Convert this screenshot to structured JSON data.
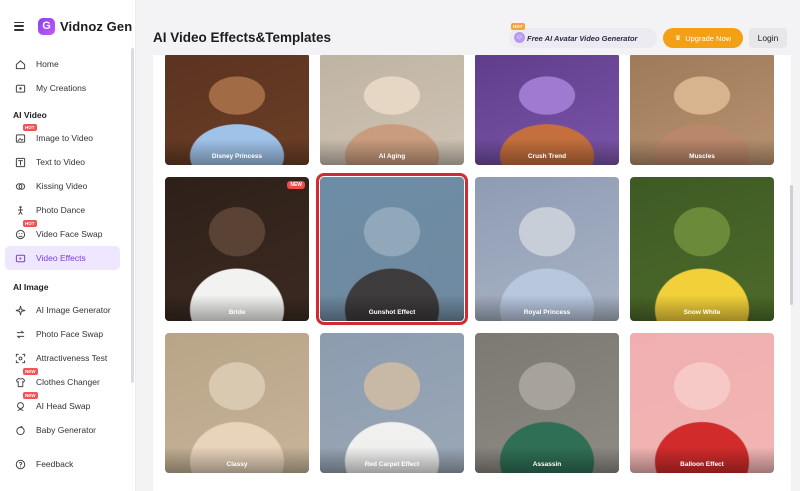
{
  "app": {
    "logo_text": "Vidnoz Gen",
    "logo_mark": "G"
  },
  "sidebar": {
    "nav": [
      {
        "label": "Home",
        "icon": "home-icon"
      },
      {
        "label": "My Creations",
        "icon": "folder-icon"
      }
    ],
    "sections": [
      {
        "title": "AI Video",
        "items": [
          {
            "label": "Image to Video",
            "icon": "image-icon",
            "tag": "HOT"
          },
          {
            "label": "Text to Video",
            "icon": "text-icon"
          },
          {
            "label": "Kissing Video",
            "icon": "kiss-icon"
          },
          {
            "label": "Photo Dance",
            "icon": "dance-icon"
          },
          {
            "label": "Video Face Swap",
            "icon": "face-swap-icon",
            "tag": "HOT"
          },
          {
            "label": "Video Effects",
            "icon": "effects-icon",
            "active": true
          }
        ]
      },
      {
        "title": "AI Image",
        "items": [
          {
            "label": "AI Image Generator",
            "icon": "sparkle-icon"
          },
          {
            "label": "Photo Face Swap",
            "icon": "swap-icon"
          },
          {
            "label": "Attractiveness Test",
            "icon": "test-icon"
          },
          {
            "label": "Clothes Changer",
            "icon": "shirt-icon",
            "tag": "NEW"
          },
          {
            "label": "AI Head Swap",
            "icon": "head-icon",
            "tag": "NEW"
          },
          {
            "label": "Baby Generator",
            "icon": "baby-icon"
          }
        ]
      }
    ],
    "footer": {
      "label": "Feedback",
      "icon": "feedback-icon"
    }
  },
  "header": {
    "title": "AI Video Effects&Templates",
    "promo_label": "Free AI Avatar Video Generator",
    "promo_tag": "HOT",
    "upgrade_label": "Upgrade Now",
    "login_label": "Login"
  },
  "cards": [
    {
      "label": "Disney Princess",
      "bg": "#6b3f26"
    },
    {
      "label": "AI Aging",
      "bg": "#cfc4b5"
    },
    {
      "label": "Crush Trend",
      "bg": "#7b55a8"
    },
    {
      "label": "Muscles",
      "bg": "#b89270"
    },
    {
      "label": "Bride",
      "bg": "#3b2a22",
      "tag": "NEW"
    },
    {
      "label": "Gunshot Effect",
      "bg": "#6f8aa0",
      "highlight": true
    },
    {
      "label": "Royal Princess",
      "bg": "#a9b3c4"
    },
    {
      "label": "Snow White",
      "bg": "#4d6b2a"
    },
    {
      "label": "Classy",
      "bg": "#c7b49a"
    },
    {
      "label": "Red Carpet Effect",
      "bg": "#9aa7b6"
    },
    {
      "label": "Assassin",
      "bg": "#8e8a84"
    },
    {
      "label": "Balloon Effect",
      "bg": "#f2b6b4"
    }
  ]
}
